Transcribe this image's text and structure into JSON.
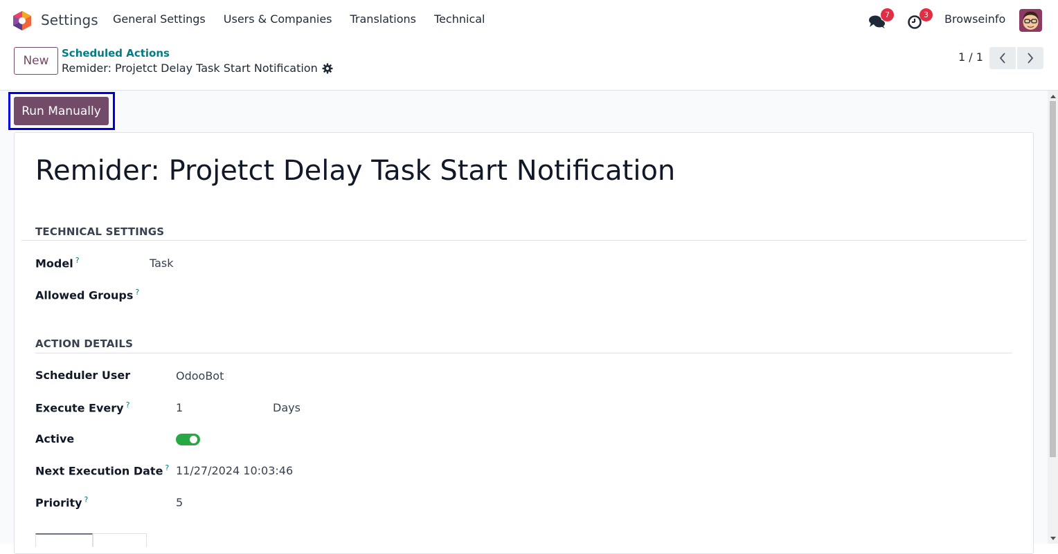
{
  "navbar": {
    "app_name": "Settings",
    "menu": [
      "General Settings",
      "Users & Companies",
      "Translations",
      "Technical"
    ],
    "chat_count": "7",
    "activity_count": "3",
    "company": "Browseinfo"
  },
  "control_panel": {
    "new_label": "New",
    "breadcrumb_parent": "Scheduled Actions",
    "breadcrumb_current": "Remider: Projetct Delay Task Start Notification",
    "pager": "1 / 1"
  },
  "form": {
    "run_manually_label": "Run Manually",
    "title": "Remider: Projetct Delay Task Start Notification",
    "help_mark": "?",
    "technical_settings": {
      "heading": "TECHNICAL SETTINGS",
      "model_label": "Model",
      "model_value": "Task",
      "allowed_groups_label": "Allowed Groups",
      "allowed_groups_value": ""
    },
    "action_details": {
      "heading": "ACTION DETAILS",
      "scheduler_user_label": "Scheduler User",
      "scheduler_user_value": "OdooBot",
      "execute_every_label": "Execute Every",
      "execute_every_value": "1",
      "execute_every_unit": "Days",
      "active_label": "Active",
      "active_value": true,
      "next_execution_label": "Next Execution Date",
      "next_execution_value": "11/27/2024 10:03:46",
      "priority_label": "Priority",
      "priority_value": "5"
    }
  },
  "colors": {
    "brand": "#714b67",
    "link": "#017e84",
    "toggle_on": "#28a745",
    "badge": "#e02f44",
    "highlight": "#0000dd"
  },
  "icons": [
    "odoo-logo-icon",
    "chat-icon",
    "clock-icon",
    "gear-icon",
    "chevron-left-icon",
    "chevron-right-icon"
  ]
}
